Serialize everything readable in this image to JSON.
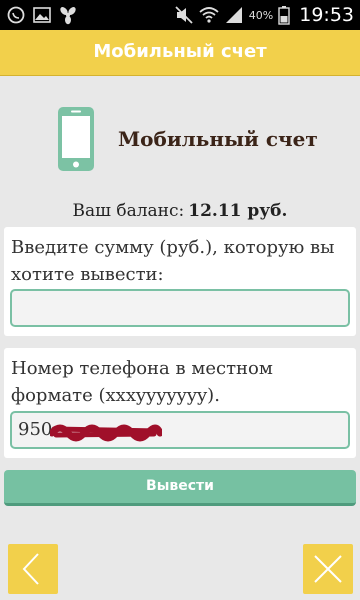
{
  "status_bar": {
    "battery_percent": "40%",
    "time": "19:53",
    "icons": [
      "whatsapp-icon",
      "image-icon",
      "fan-icon",
      "mute-icon",
      "wifi-icon",
      "signal-icon",
      "battery-icon"
    ]
  },
  "title_bar": {
    "title": "Мобильный счет"
  },
  "header": {
    "title": "Мобильный счет",
    "icon": "phone-icon"
  },
  "balance": {
    "label": "Ваш баланс:",
    "value": "12.11 руб."
  },
  "amount_card": {
    "label": "Введите сумму (руб.), которую вы хотите вывести:",
    "value": "",
    "placeholder": ""
  },
  "phone_card": {
    "label": "Номер телефона в местном формате (xxxyyyyyyy).",
    "value": "950"
  },
  "submit": {
    "label": "Вывести"
  },
  "nav": {
    "back_icon": "chevron-left-icon",
    "close_icon": "close-icon"
  },
  "colors": {
    "accent_yellow": "#f2d04b",
    "accent_green": "#76c1a2",
    "title_dark": "#3b2418",
    "background": "#e8e8e8"
  }
}
